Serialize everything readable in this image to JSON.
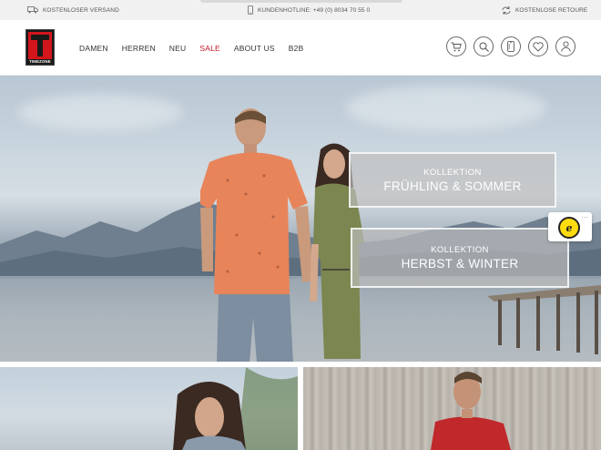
{
  "topbar": {
    "shipping": "KOSTENLOSER VERSAND",
    "hotline": "KUNDENHOTLINE: +49 (0) 8034 70 55 0",
    "returns": "KOSTENLOSE RETOURE"
  },
  "logo": {
    "text": "TIMEZONE"
  },
  "nav": {
    "items": [
      "DAMEN",
      "HERREN",
      "NEU",
      "SALE",
      "ABOUT US",
      "B2B"
    ]
  },
  "header_icons": [
    "cart-icon",
    "search-icon",
    "phone-icon",
    "heart-icon",
    "user-icon"
  ],
  "hero": {
    "panel1": {
      "line1": "KOLLEKTION",
      "line2": "FRÜHLING & SOMMER"
    },
    "panel2": {
      "line1": "KOLLEKTION",
      "line2": "HERBST & WINTER"
    }
  },
  "trust_badge": {
    "dots": "...",
    "symbol": "e"
  },
  "colors": {
    "sale": "#c0152a",
    "brand_red": "#d2161b",
    "topbar_bg": "#f1f1f1"
  }
}
